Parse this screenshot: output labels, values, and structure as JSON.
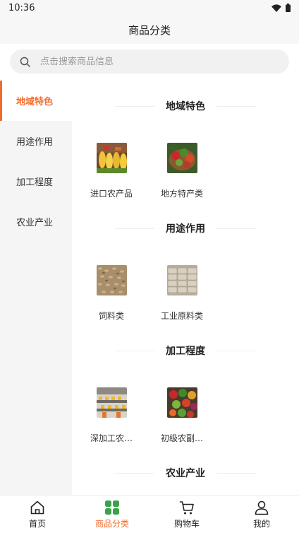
{
  "status": {
    "time": "10:36"
  },
  "header": {
    "title": "商品分类"
  },
  "search": {
    "placeholder": "点击搜索商品信息"
  },
  "colors": {
    "accent": "#f26b2a",
    "category_green": "#3aa34a"
  },
  "sidebar": {
    "items": [
      {
        "label": "地域特色",
        "active": true
      },
      {
        "label": "用途作用",
        "active": false
      },
      {
        "label": "加工程度",
        "active": false
      },
      {
        "label": "农业产业",
        "active": false
      }
    ]
  },
  "sections": [
    {
      "title": "地域特色",
      "items": [
        {
          "label": "进口农产品",
          "icon": "corn-photo"
        },
        {
          "label": "地方特产类",
          "icon": "vegetable-basket-photo"
        }
      ]
    },
    {
      "title": "用途作用",
      "items": [
        {
          "label": "饲料类",
          "icon": "grain-photo"
        },
        {
          "label": "工业原料类",
          "icon": "sacks-photo"
        }
      ]
    },
    {
      "title": "加工程度",
      "items": [
        {
          "label": "深加工农…",
          "icon": "factory-line-photo"
        },
        {
          "label": "初级农副…",
          "icon": "fresh-produce-photo"
        }
      ]
    },
    {
      "title": "农业产业",
      "items": []
    }
  ],
  "tabbar": {
    "items": [
      {
        "label": "首页",
        "icon": "home-icon",
        "active": false
      },
      {
        "label": "商品分类",
        "icon": "category-grid-icon",
        "active": true
      },
      {
        "label": "购物车",
        "icon": "cart-icon",
        "active": false
      },
      {
        "label": "我的",
        "icon": "user-icon",
        "active": false
      }
    ]
  }
}
